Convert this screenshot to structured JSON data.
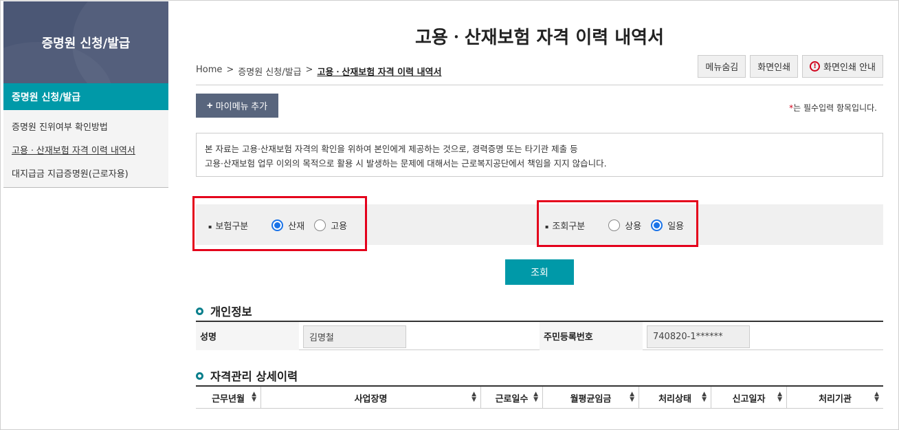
{
  "sidebar": {
    "title": "증명원 신청/발급",
    "active": "증명원 신청/발급",
    "items": [
      {
        "label": "증명원 진위여부 확인방법"
      },
      {
        "label": "고용ㆍ산재보험 자격 이력 내역서"
      },
      {
        "label": "대지급금 지급증명원(근로자용)"
      }
    ]
  },
  "page": {
    "title": "고용ㆍ산재보험 자격 이력 내역서",
    "breadcrumb": [
      "Home",
      "증명원 신청/발급",
      "고용ㆍ산재보험 자격 이력 내역서"
    ],
    "sep": ">",
    "buttons": {
      "hide_menu": "메뉴숨김",
      "print": "화면인쇄",
      "print_guide": "화면인쇄 안내"
    },
    "mymenu": "마이메뉴 추가",
    "required_star": "*",
    "required_note": "는 필수입력 항목입니다.",
    "notice": [
      "본 자료는 고용·산재보험 자격의 확인을 위하여 본인에게 제공하는 것으로, 경력증명 또는 타기관 제출 등",
      "고용·산재보험 업무 이외의 목적으로 활용 시 발생하는 문제에 대해서는 근로복지공단에서 책임을 지지 않습니다."
    ]
  },
  "search": {
    "insurance": {
      "label": "보험구분",
      "options": [
        "산재",
        "고용"
      ],
      "selected": "산재"
    },
    "lookup": {
      "label": "조회구분",
      "options": [
        "상용",
        "일용"
      ],
      "selected": "일용"
    },
    "button": "조회"
  },
  "personal": {
    "title": "개인정보",
    "name_label": "성명",
    "name_value": "김명철",
    "rrn_label": "주민등록번호",
    "rrn_value": "740820-1******"
  },
  "history": {
    "title": "자격관리 상세이력",
    "columns": [
      "근무년월",
      "사업장명",
      "근로일수",
      "월평균임금",
      "처리상태",
      "신고일자",
      "처리기관"
    ]
  },
  "colors": {
    "accent": "#0099a8",
    "sidebar_head": "#4b5775",
    "highlight_box": "#e4001b"
  }
}
